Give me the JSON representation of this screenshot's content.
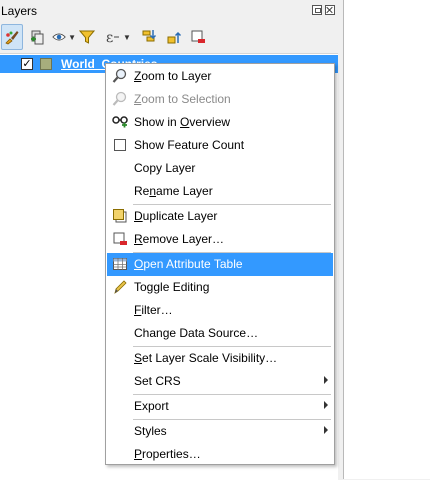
{
  "panel": {
    "title": "Layers"
  },
  "toolbar": {
    "buttons": [
      {
        "icon": "paintbrush-icon",
        "active": true
      },
      {
        "icon": "add-group-icon"
      },
      {
        "icon": "eye-icon",
        "dropdown": true
      },
      {
        "icon": "filter-icon"
      },
      {
        "icon": "filter-expression-icon",
        "dropdown": true
      },
      {
        "icon": "expand-all-icon"
      },
      {
        "icon": "collapse-all-icon"
      },
      {
        "icon": "remove-layer-icon"
      }
    ]
  },
  "tree": {
    "layer": {
      "checked": "✓",
      "name": "World_Countries",
      "swatch_color": "#a7ad7d"
    }
  },
  "menu": {
    "items": [
      {
        "pre": "",
        "ul": "Z",
        "post": "oom to Layer",
        "icon": "zoom-icon"
      },
      {
        "pre": "",
        "ul": "Z",
        "post": "oom to Selection",
        "icon": "zoom-icon",
        "disabled": true
      },
      {
        "pre": "Show in ",
        "ul": "O",
        "post": "verview",
        "icon": "overview-glasses-icon"
      },
      {
        "pre": "Show Feature Count",
        "ul": "",
        "post": "",
        "icon": "checkbox-icon"
      },
      {
        "pre": "Copy Layer",
        "ul": "",
        "post": ""
      },
      {
        "pre": "Re",
        "ul": "n",
        "post": "ame Layer"
      },
      {
        "pre": "",
        "ul": "D",
        "post": "uplicate Layer",
        "icon": "duplicate-layer-icon"
      },
      {
        "pre": "",
        "ul": "R",
        "post": "emove Layer…",
        "icon": "remove-layer-icon"
      },
      {
        "pre": "",
        "ul": "O",
        "post": "pen Attribute Table",
        "icon": "attribute-table-icon",
        "highlighted": true
      },
      {
        "pre": "Toggle Editing",
        "ul": "",
        "post": "",
        "icon": "pencil-icon"
      },
      {
        "pre": "",
        "ul": "F",
        "post": "ilter…"
      },
      {
        "pre": "Change Data Source…",
        "ul": "",
        "post": ""
      },
      {
        "pre": "",
        "ul": "S",
        "post": "et Layer Scale Visibility…"
      },
      {
        "pre": "Set CRS",
        "ul": "",
        "post": "",
        "submenu": true
      },
      {
        "pre": "Export",
        "ul": "",
        "post": "",
        "submenu": true
      },
      {
        "pre": "Styles",
        "ul": "",
        "post": "",
        "submenu": true
      },
      {
        "pre": "",
        "ul": "P",
        "post": "roperties…"
      }
    ]
  },
  "colors": {
    "highlight": "#3399ff",
    "active_tool": "#cfe4f7"
  }
}
